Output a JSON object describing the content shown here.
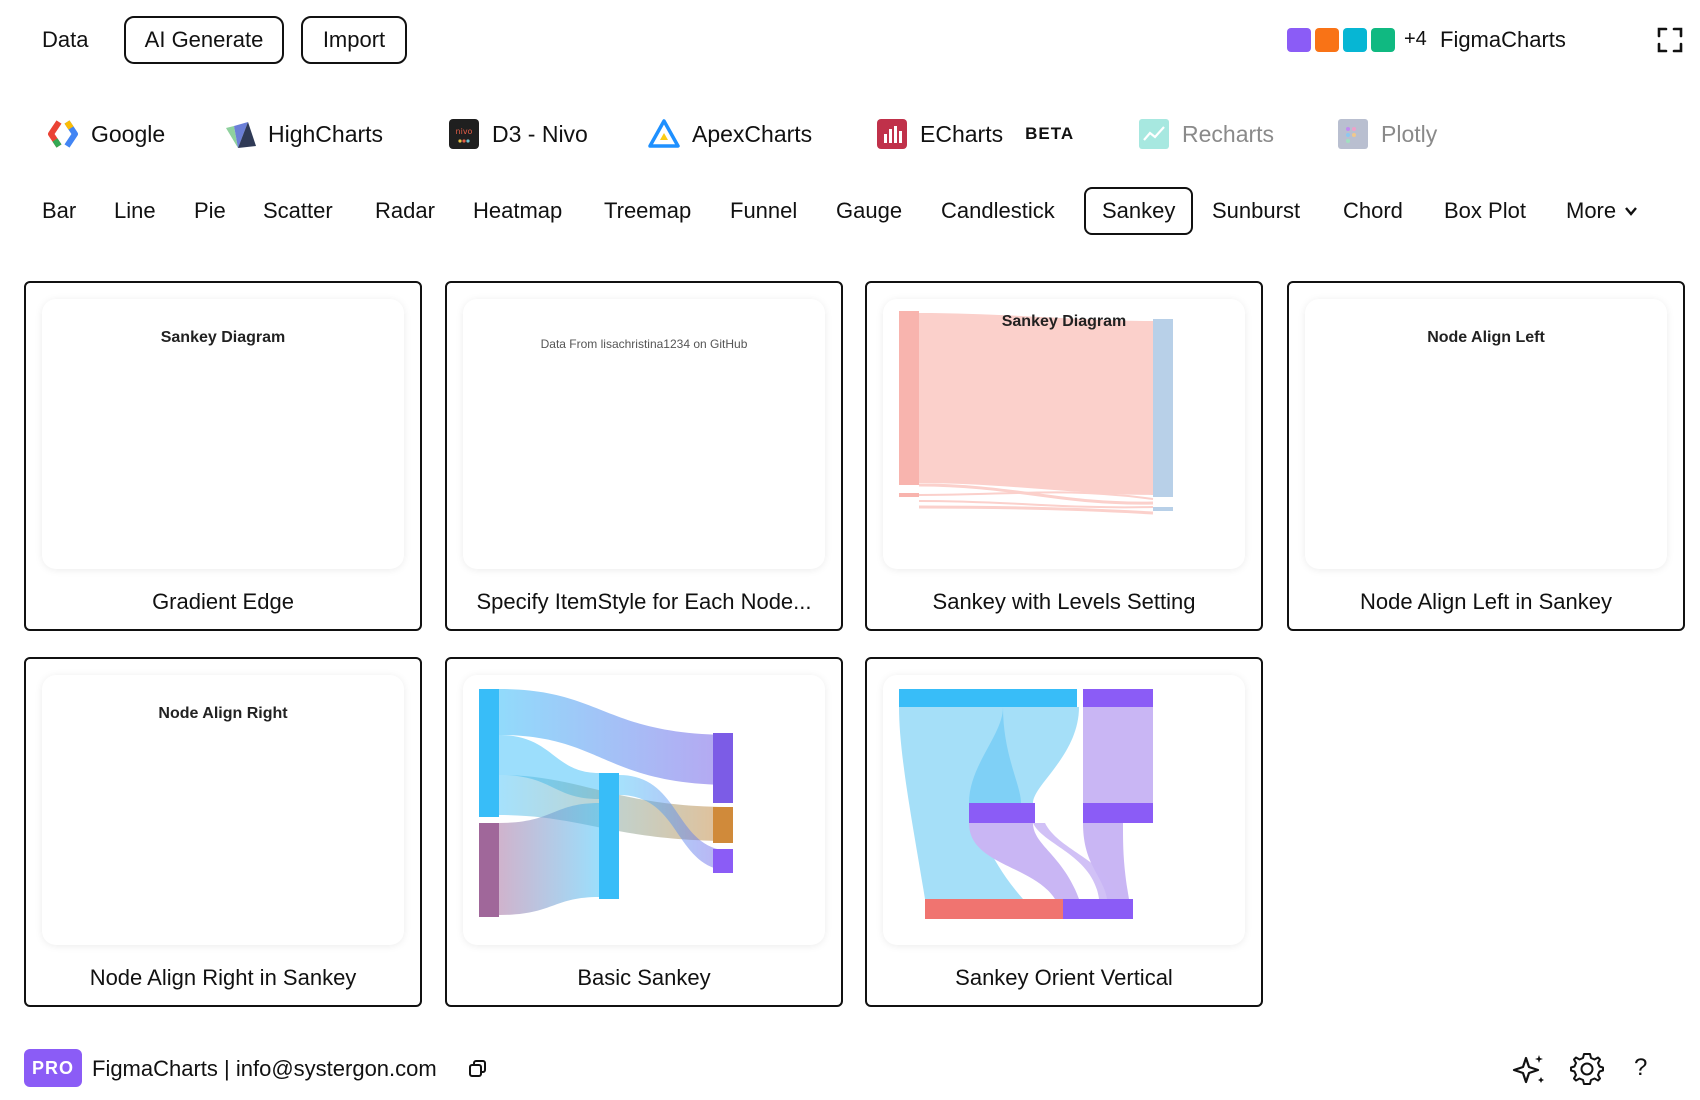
{
  "topbar": {
    "data_label": "Data",
    "ai_label": "AI Generate",
    "import_label": "Import",
    "plus_count": "+4",
    "brand": "FigmaCharts",
    "swatches": [
      "#8b5cf6",
      "#f97316",
      "#06b6d4",
      "#10b981"
    ],
    "fullscreen_icon": "fullscreen-icon"
  },
  "libraries": [
    {
      "name": "Google",
      "icon": "google-icon"
    },
    {
      "name": "HighCharts",
      "icon": "highcharts-icon"
    },
    {
      "name": "D3 - Nivo",
      "icon": "nivo-icon"
    },
    {
      "name": "ApexCharts",
      "icon": "apexcharts-icon"
    },
    {
      "name": "ECharts",
      "icon": "echarts-icon",
      "badge": "BETA"
    },
    {
      "name": "Recharts",
      "icon": "recharts-icon"
    },
    {
      "name": "Plotly",
      "icon": "plotly-icon"
    }
  ],
  "chart_types": [
    "Bar",
    "Line",
    "Pie",
    "Scatter",
    "Radar",
    "Heatmap",
    "Treemap",
    "Funnel",
    "Gauge",
    "Candlestick",
    "Sankey",
    "Sunburst",
    "Chord",
    "Box Plot",
    "More"
  ],
  "active_type": "Sankey",
  "cards": [
    {
      "label": "Gradient Edge",
      "thumb_title": "Sankey Diagram"
    },
    {
      "label": "Specify ItemStyle for Each Node...",
      "thumb_sub": "Data From lisachristina1234 on GitHub"
    },
    {
      "label": "Sankey with Levels Setting",
      "thumb_title": "Sankey Diagram"
    },
    {
      "label": "Node Align Left in Sankey",
      "thumb_title": "Node Align Left"
    },
    {
      "label": "Node Align Right in Sankey",
      "thumb_title": "Node Align Right"
    },
    {
      "label": "Basic Sankey"
    },
    {
      "label": "Sankey Orient Vertical"
    }
  ],
  "footer": {
    "badge": "PRO",
    "text": "FigmaCharts | info@systergon.com",
    "help": "?"
  },
  "colors": {
    "accent": "#8b5cf6",
    "sankey_blue": "#38bdf8",
    "sankey_purple": "#7c5ce6",
    "sankey_orange": "#d08a3a",
    "sankey_red": "#f07470",
    "levels_pink": "#f8b4ae",
    "levels_blue": "#b8d0e8"
  }
}
